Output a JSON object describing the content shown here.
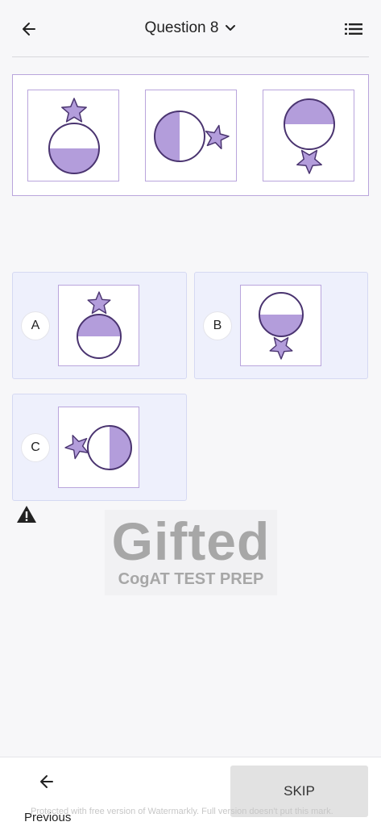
{
  "header": {
    "title": "Question 8",
    "back_icon": "arrow-left-icon",
    "dropdown_icon": "chevron-down-icon",
    "list_icon": "list-icon"
  },
  "question": {
    "figures": [
      {
        "shape": "circle",
        "filled_half": "bottom",
        "star_position": "top"
      },
      {
        "shape": "circle",
        "filled_half": "left",
        "star_position": "right"
      },
      {
        "shape": "circle",
        "filled_half": "top",
        "star_position": "bottom"
      }
    ]
  },
  "options": [
    {
      "letter": "A",
      "filled_half": "top",
      "star_position": "top"
    },
    {
      "letter": "B",
      "filled_half": "bottom",
      "star_position": "bottom"
    },
    {
      "letter": "C",
      "filled_half": "right",
      "star_position": "left"
    }
  ],
  "report_icon": "warning-icon",
  "logo": {
    "main": "Gifted",
    "sub": "CogAT TEST PREP"
  },
  "footer": {
    "previous_label": "Previous",
    "skip_label": "SKIP"
  },
  "watermark": "Protected with free version of Watermarkly. Full version doesn't put this mark.",
  "colors": {
    "accent_fill": "#b39ddb",
    "stroke": "#4a3470",
    "option_bg": "#eef0fc",
    "frame": "#b9a5dc"
  }
}
